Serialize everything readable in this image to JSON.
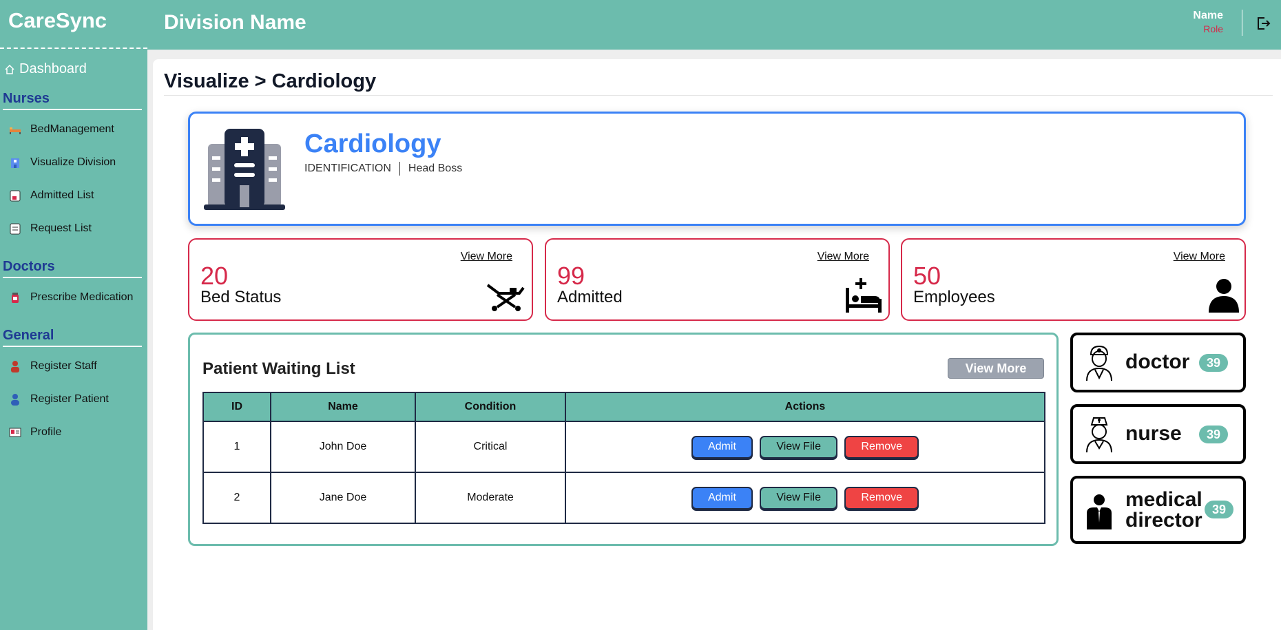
{
  "brand": "CareSync",
  "header": {
    "division": "Division Name",
    "user_name": "Name",
    "user_role": "Role"
  },
  "sidebar": {
    "dashboard": "Dashboard",
    "sections": [
      {
        "title": "Nurses",
        "items": [
          "BedManagement",
          "Visualize Division",
          "Admitted List",
          "Request List"
        ]
      },
      {
        "title": "Doctors",
        "items": [
          "Prescribe Medication"
        ]
      },
      {
        "title": "General",
        "items": [
          "Register Staff",
          "Register Patient",
          "Profile"
        ]
      }
    ]
  },
  "breadcrumb": "Visualize > Cardiology",
  "hero": {
    "title": "Cardiology",
    "id_label": "IDENTIFICATION",
    "head": "Head Boss"
  },
  "stats": [
    {
      "value": "20",
      "label": "Bed Status",
      "more": "View More",
      "icon": "stretcher-icon"
    },
    {
      "value": "99",
      "label": "Admitted",
      "more": "View More",
      "icon": "patient-bed-icon"
    },
    {
      "value": "50",
      "label": "Employees",
      "more": "View More",
      "icon": "person-icon"
    }
  ],
  "waiting": {
    "title": "Patient Waiting List",
    "more": "View More",
    "columns": [
      "ID",
      "Name",
      "Condition",
      "Actions"
    ],
    "rows": [
      {
        "id": "1",
        "name": "John Doe",
        "condition": "Critical"
      },
      {
        "id": "2",
        "name": "Jane Doe",
        "condition": "Moderate"
      }
    ],
    "actions": {
      "admit": "Admit",
      "view": "View File",
      "remove": "Remove"
    }
  },
  "roles": [
    {
      "name": "doctor",
      "count": "39",
      "icon": "doctor-icon"
    },
    {
      "name": "nurse",
      "count": "39",
      "icon": "nurse-icon"
    },
    {
      "name_line1": "medical",
      "name_line2": "director",
      "count": "39",
      "icon": "director-icon"
    }
  ],
  "colors": {
    "teal": "#6cbcad",
    "blue": "#3b82f6",
    "red": "#d6294a",
    "navy": "#1f3a93"
  }
}
